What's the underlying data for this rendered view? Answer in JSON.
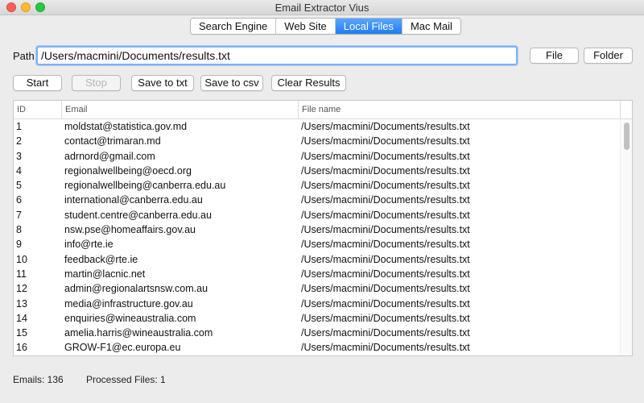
{
  "window": {
    "title": "Email Extractor Vius"
  },
  "tabs": [
    {
      "label": "Search Engine",
      "active": false
    },
    {
      "label": "Web Site",
      "active": false
    },
    {
      "label": "Local Files",
      "active": true
    },
    {
      "label": "Mac Mail",
      "active": false
    }
  ],
  "path": {
    "label": "Path:",
    "value": "/Users/macmini/Documents/results.txt"
  },
  "buttons": {
    "file": "File",
    "folder": "Folder",
    "start": "Start",
    "stop": "Stop",
    "save_txt": "Save to txt",
    "save_csv": "Save to csv",
    "clear": "Clear Results"
  },
  "table": {
    "columns": [
      "ID",
      "Email",
      "File name"
    ],
    "rows": [
      {
        "id": "1",
        "email": "moldstat@statistica.gov.md",
        "file": "/Users/macmini/Documents/results.txt"
      },
      {
        "id": "2",
        "email": "contact@trimaran.md",
        "file": "/Users/macmini/Documents/results.txt"
      },
      {
        "id": "3",
        "email": "adrnord@gmail.com",
        "file": "/Users/macmini/Documents/results.txt"
      },
      {
        "id": "4",
        "email": "regionalwellbeing@oecd.org",
        "file": "/Users/macmini/Documents/results.txt"
      },
      {
        "id": "5",
        "email": "regionalwellbeing@canberra.edu.au",
        "file": "/Users/macmini/Documents/results.txt"
      },
      {
        "id": "6",
        "email": "international@canberra.edu.au",
        "file": "/Users/macmini/Documents/results.txt"
      },
      {
        "id": "7",
        "email": "student.centre@canberra.edu.au",
        "file": "/Users/macmini/Documents/results.txt"
      },
      {
        "id": "8",
        "email": "nsw.pse@homeaffairs.gov.au",
        "file": "/Users/macmini/Documents/results.txt"
      },
      {
        "id": "9",
        "email": "info@rte.ie",
        "file": "/Users/macmini/Documents/results.txt"
      },
      {
        "id": "10",
        "email": "feedback@rte.ie",
        "file": "/Users/macmini/Documents/results.txt"
      },
      {
        "id": "11",
        "email": "martin@lacnic.net",
        "file": "/Users/macmini/Documents/results.txt"
      },
      {
        "id": "12",
        "email": "admin@regionalartsnsw.com.au",
        "file": "/Users/macmini/Documents/results.txt"
      },
      {
        "id": "13",
        "email": "media@infrastructure.gov.au",
        "file": "/Users/macmini/Documents/results.txt"
      },
      {
        "id": "14",
        "email": "enquiries@wineaustralia.com",
        "file": "/Users/macmini/Documents/results.txt"
      },
      {
        "id": "15",
        "email": "amelia.harris@wineaustralia.com",
        "file": "/Users/macmini/Documents/results.txt"
      },
      {
        "id": "16",
        "email": "GROW-F1@ec.europa.eu",
        "file": "/Users/macmini/Documents/results.txt"
      }
    ]
  },
  "status": {
    "emails": "Emails: 136",
    "processed": "Processed Files: 1"
  },
  "colors": {
    "accent": "#1f7cf2",
    "focus_ring": "#7eb2f4"
  }
}
